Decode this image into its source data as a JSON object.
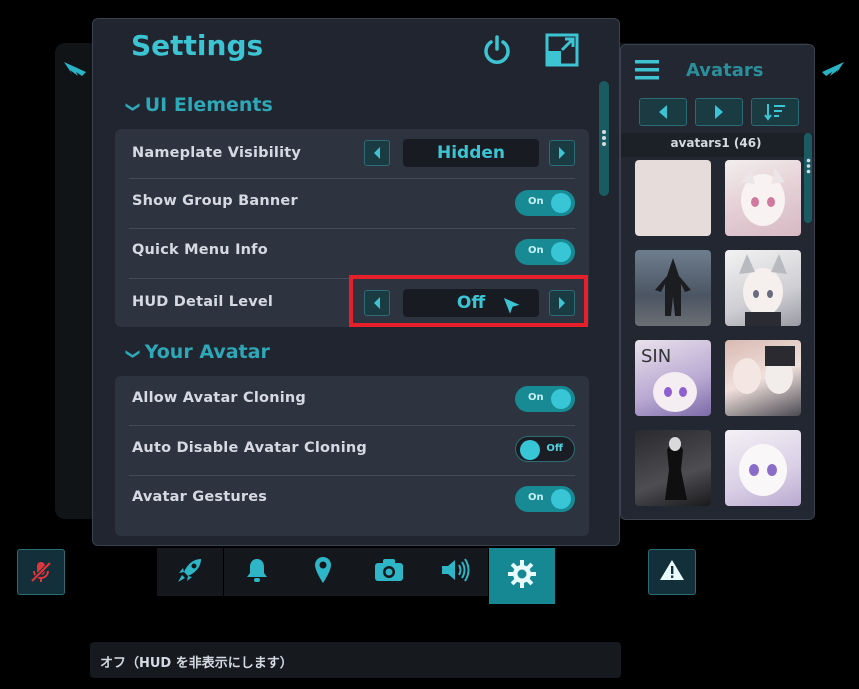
{
  "settings": {
    "title": "Settings",
    "sections": [
      {
        "title": "UI Elements",
        "rows": [
          {
            "label": "Nameplate Visibility",
            "control": "selector",
            "value": "Hidden"
          },
          {
            "label": "Show Group Banner",
            "control": "toggle",
            "value": "On"
          },
          {
            "label": "Quick Menu Info",
            "control": "toggle",
            "value": "On"
          },
          {
            "label": "HUD Detail Level",
            "control": "selector",
            "value": "Off"
          }
        ]
      },
      {
        "title": "Your Avatar",
        "rows": [
          {
            "label": "Allow Avatar Cloning",
            "control": "toggle",
            "value": "On"
          },
          {
            "label": "Auto Disable Avatar Cloning",
            "control": "toggle",
            "value": "Off"
          },
          {
            "label": "Avatar Gestures",
            "control": "toggle",
            "value": "On"
          }
        ]
      }
    ]
  },
  "avatars": {
    "title": "Avatars",
    "list_name": "avatars1 (46)",
    "thumbs": [
      "blank",
      "silver-hair-girl",
      "dark-figure",
      "cat-ear-girl",
      "sin-girl",
      "two-girls",
      "dark-warrior",
      "sample-girl"
    ]
  },
  "tooltip": "オフ（HUD を非表示にします）",
  "colors": {
    "accent": "#3cc4d3",
    "active_tab": "#158893",
    "highlight": "#e5202a",
    "muted_mic": "#e0353c"
  },
  "icons": {
    "power": "power-icon",
    "expand": "expand-icon",
    "menu": "hamburger-icon",
    "sort": "sort-icon",
    "tabs": [
      "rocket-icon",
      "bell-icon",
      "location-pin-icon",
      "camera-icon",
      "speaker-icon",
      "gear-icon"
    ],
    "mic": "muted-mic-icon",
    "warning": "warning-icon"
  }
}
